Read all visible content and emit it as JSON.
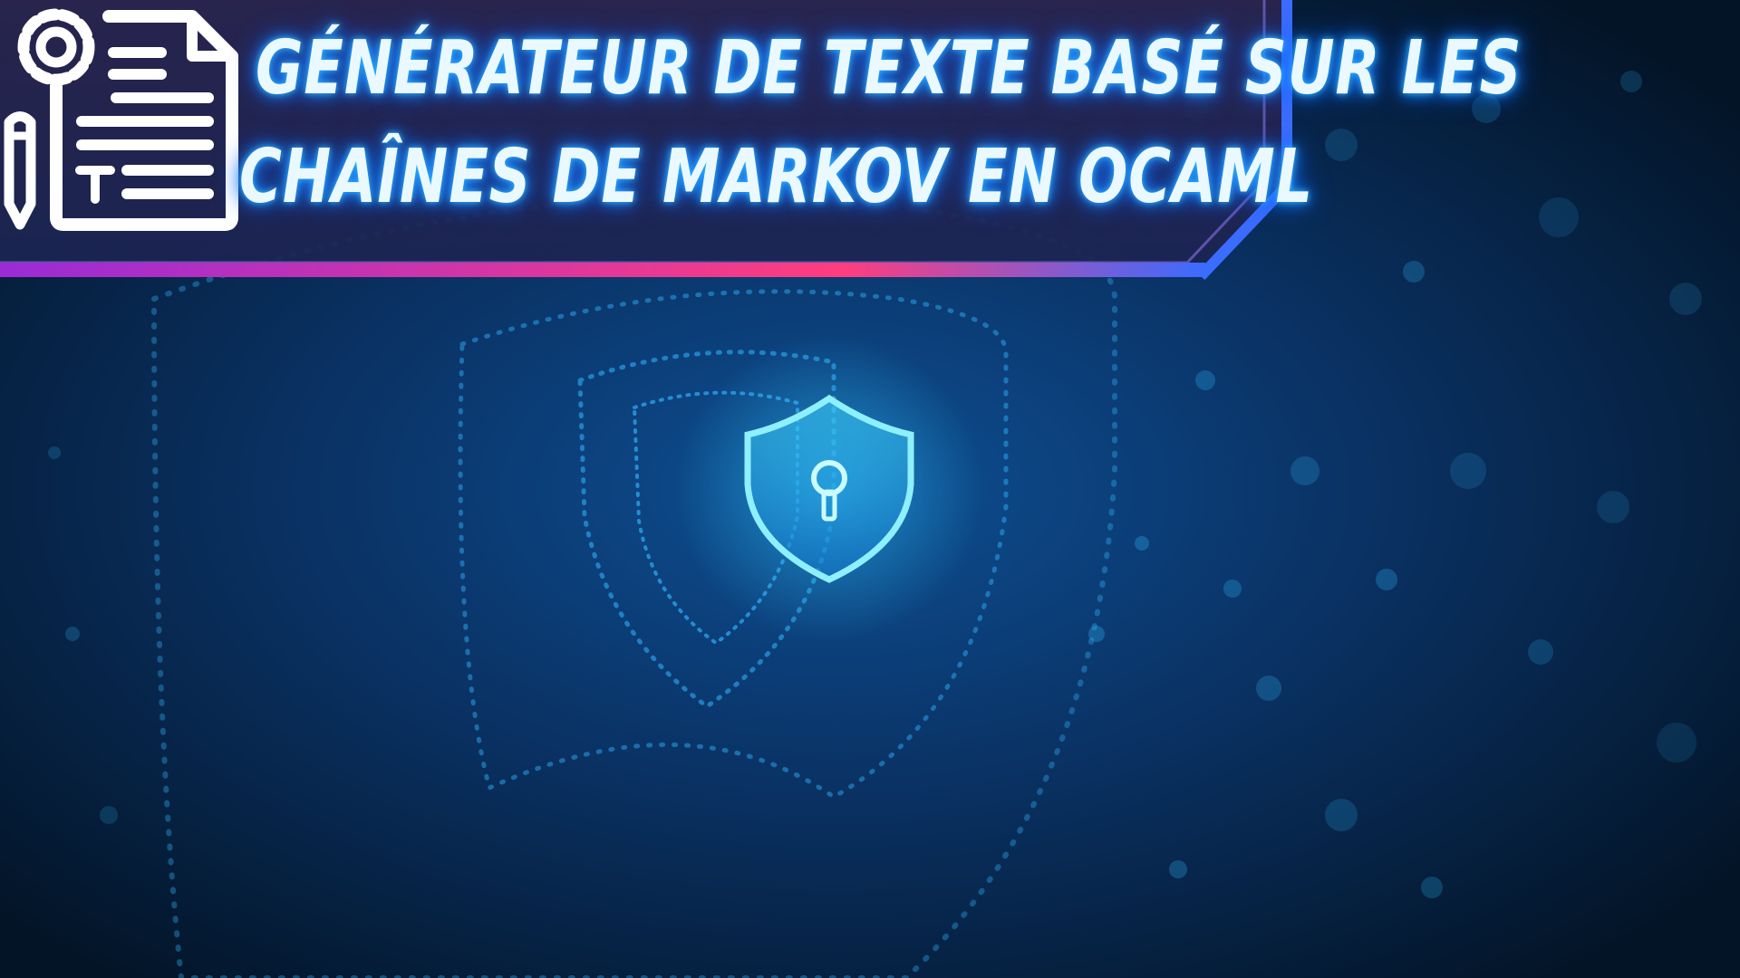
{
  "header": {
    "title_line1": "GÉNÉRATEUR DE TEXTE BASÉ SUR LES",
    "title_line2": "CHAÎNES DE MARKOV EN OCAML",
    "icon": "document-settings-icon"
  },
  "background": {
    "central_icon": "shield-keyhole-icon"
  },
  "colors": {
    "background": "#051a33",
    "glow": "#2fc8ff",
    "banner_fill": "#1b2450",
    "banner_border": "#3a6cff",
    "accent_pink": "#ff3d7f",
    "accent_purple": "#9a2bd6"
  }
}
